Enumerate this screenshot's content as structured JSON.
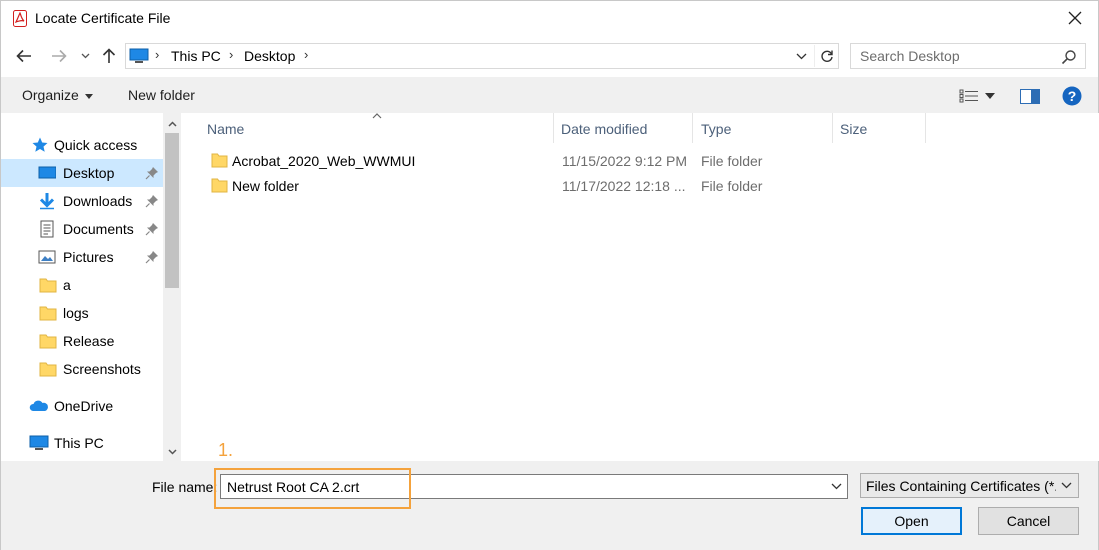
{
  "window": {
    "title": "Locate Certificate File",
    "close_label": "Close"
  },
  "address": {
    "crumbs": [
      "This PC",
      "Desktop"
    ],
    "search_placeholder": "Search Desktop"
  },
  "toolbar": {
    "organize_label": "Organize",
    "new_folder_label": "New folder"
  },
  "nav": {
    "items": [
      {
        "label": "Quick access",
        "icon": "star-icon"
      },
      {
        "label": "Desktop",
        "icon": "desktop-icon",
        "pinned": true,
        "selected": true
      },
      {
        "label": "Downloads",
        "icon": "download-icon",
        "pinned": true
      },
      {
        "label": "Documents",
        "icon": "documents-icon",
        "pinned": true
      },
      {
        "label": "Pictures",
        "icon": "pictures-icon",
        "pinned": true
      },
      {
        "label": "a",
        "icon": "folder-icon"
      },
      {
        "label": "logs",
        "icon": "folder-icon"
      },
      {
        "label": "Release",
        "icon": "folder-icon"
      },
      {
        "label": "Screenshots",
        "icon": "folder-icon"
      },
      {
        "label": "OneDrive",
        "icon": "cloud-icon"
      },
      {
        "label": "This PC",
        "icon": "computer-icon"
      }
    ]
  },
  "filelist": {
    "columns": [
      "Name",
      "Date modified",
      "Type",
      "Size"
    ],
    "rows": [
      {
        "name": "Acrobat_2020_Web_WWMUI",
        "date": "11/15/2022 9:12 PM",
        "type": "File folder",
        "size": ""
      },
      {
        "name": "New folder",
        "date": "11/17/2022 12:18 ...",
        "type": "File folder",
        "size": ""
      }
    ]
  },
  "bottom": {
    "file_name_label": "File name:",
    "file_name_value": "Netrust Root CA 2.crt",
    "file_type_value": "Files Containing Certificates (*.c",
    "open_label": "Open",
    "cancel_label": "Cancel",
    "annotation_label": "1."
  },
  "colors": {
    "accent": "#0078d7",
    "selection": "#cce8ff",
    "annotation": "#f4a23c",
    "folder": "#ffd766"
  }
}
